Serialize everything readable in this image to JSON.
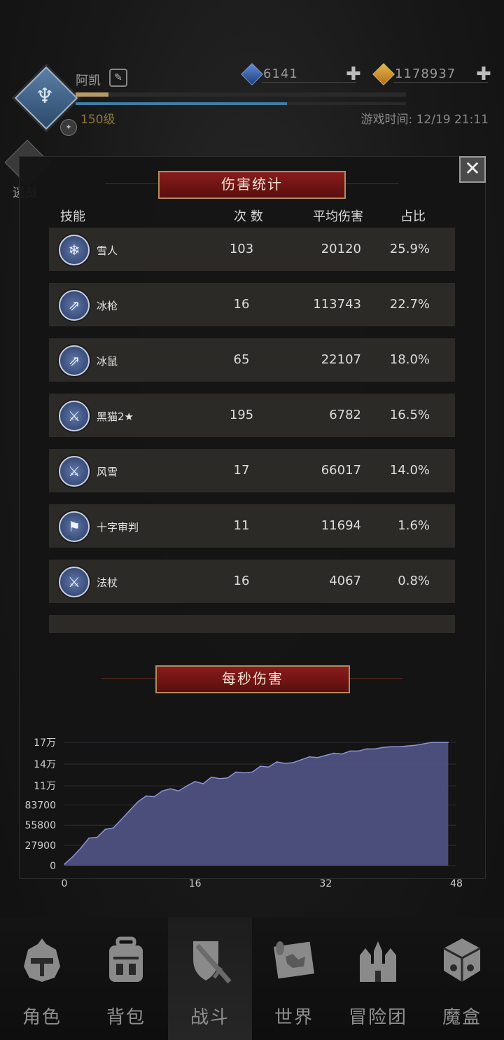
{
  "player": {
    "name": "阿凯",
    "level": "150级",
    "game_time": "游戏时间: 12/19 21:11",
    "exp_fraction": 0.1,
    "mp_fraction": 0.64
  },
  "currencies": [
    {
      "icon": "blue-gem-icon",
      "value": "6141",
      "plus": "✚"
    },
    {
      "icon": "gold-gem-icon",
      "value": "1178937",
      "plus": "✚"
    }
  ],
  "retreat": {
    "label": "逃战"
  },
  "damage_stats": {
    "title": "伤害统计",
    "close": "✕",
    "headers": {
      "skill": "技能",
      "count": "次 数",
      "avg": "平均伤害",
      "ratio": "占比"
    },
    "rows": [
      {
        "name": "雪人",
        "icon": "snowflake-icon",
        "glyph": "❄",
        "count": "103",
        "avg": "20120",
        "ratio": "25.9%"
      },
      {
        "name": "冰枪",
        "icon": "ice-spear-icon",
        "glyph": "⇗",
        "count": "16",
        "avg": "113743",
        "ratio": "22.7%"
      },
      {
        "name": "冰鼠",
        "icon": "ice-spear-icon",
        "glyph": "⇗",
        "count": "65",
        "avg": "22107",
        "ratio": "18.0%"
      },
      {
        "name": "黑猫2★",
        "icon": "sword-icon",
        "glyph": "⚔",
        "count": "195",
        "avg": "6782",
        "ratio": "16.5%"
      },
      {
        "name": "风雪",
        "icon": "sword-icon",
        "glyph": "⚔",
        "count": "17",
        "avg": "66017",
        "ratio": "14.0%"
      },
      {
        "name": "十字审判",
        "icon": "banner-icon",
        "glyph": "⚑",
        "count": "11",
        "avg": "11694",
        "ratio": "1.6%"
      },
      {
        "name": "法杖",
        "icon": "sword-icon",
        "glyph": "⚔",
        "count": "16",
        "avg": "4067",
        "ratio": "0.8%"
      }
    ]
  },
  "dps": {
    "title": "每秒伤害",
    "colors": {
      "area": "#4e5080",
      "line": "#8f93d6"
    }
  },
  "chart_data": {
    "type": "area",
    "title": "每秒伤害",
    "xlabel": "",
    "ylabel": "",
    "x_ticks": [
      0,
      16,
      32,
      48
    ],
    "y_ticks": [
      {
        "value": 0,
        "label": "0"
      },
      {
        "value": 27900,
        "label": "27900"
      },
      {
        "value": 55800,
        "label": "55800"
      },
      {
        "value": 83700,
        "label": "83700"
      },
      {
        "value": 110000,
        "label": "11万"
      },
      {
        "value": 140000,
        "label": "14万"
      },
      {
        "value": 170000,
        "label": "17万"
      }
    ],
    "xlim": [
      0,
      48
    ],
    "ylim": [
      0,
      170000
    ],
    "x": [
      0,
      1,
      2,
      3,
      4,
      5,
      6,
      7,
      8,
      9,
      10,
      11,
      12,
      13,
      14,
      15,
      16,
      17,
      18,
      19,
      20,
      21,
      22,
      23,
      24,
      25,
      26,
      27,
      28,
      29,
      30,
      31,
      32,
      33,
      34,
      35,
      36,
      37,
      38,
      39,
      40,
      41,
      42,
      43,
      44,
      45,
      46,
      47
    ],
    "values": [
      2000,
      12000,
      24000,
      38000,
      39000,
      50000,
      52000,
      64000,
      76000,
      88000,
      96000,
      95000,
      103000,
      106000,
      103000,
      110000,
      116000,
      113000,
      122000,
      120000,
      121000,
      129000,
      128000,
      129000,
      137000,
      136000,
      143000,
      141000,
      142000,
      146000,
      150000,
      149000,
      152000,
      155000,
      154000,
      158000,
      158000,
      161000,
      161000,
      163000,
      164000,
      164000,
      165000,
      166000,
      168000,
      170000,
      170000,
      170000
    ],
    "grid": true
  },
  "nav": [
    {
      "label": "角色",
      "icon": "helmet-icon",
      "active": false
    },
    {
      "label": "背包",
      "icon": "backpack-icon",
      "active": false
    },
    {
      "label": "战斗",
      "icon": "shield-sword-icon",
      "active": true
    },
    {
      "label": "世界",
      "icon": "map-scroll-icon",
      "active": false
    },
    {
      "label": "冒险团",
      "icon": "castle-icon",
      "active": false
    },
    {
      "label": "魔盒",
      "icon": "magic-cube-icon",
      "active": false
    }
  ]
}
